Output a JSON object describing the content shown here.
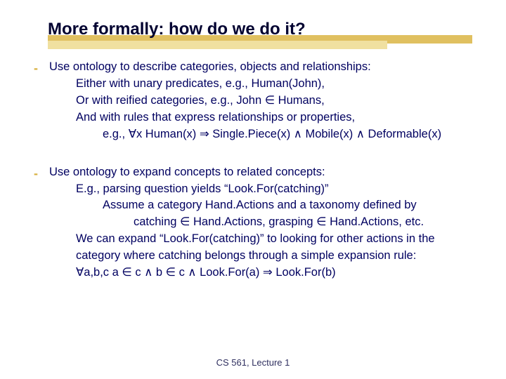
{
  "title": "More formally: how do we do it?",
  "bullet1": {
    "l0": "Use ontology to describe categories, objects and relationships:",
    "l1": "Either with unary predicates, e.g., Human(John),",
    "l2": "Or with reified categories, e.g., John ∈ Humans,",
    "l3": "And with rules that express relationships or properties,",
    "l4": "e.g., ∀x Human(x) ⇒ Single.Piece(x) ∧ Mobile(x) ∧ Deformable(x)"
  },
  "bullet2": {
    "l0": "Use ontology to expand concepts to related concepts:",
    "l1": "E.g., parsing question yields “Look.For(catching)”",
    "l2": "Assume a category Hand.Actions and a taxonomy defined by",
    "l3": "catching ∈ Hand.Actions, grasping ∈ Hand.Actions, etc.",
    "l4": "We can expand “Look.For(catching)” to looking for other actions in the",
    "l5": "category where catching belongs through a simple expansion rule:",
    "l6": "∀a,b,c   a ∈ c ∧ b ∈ c ∧ Look.For(a) ⇒ Look.For(b)"
  },
  "footer": "CS 561,  Lecture 1"
}
